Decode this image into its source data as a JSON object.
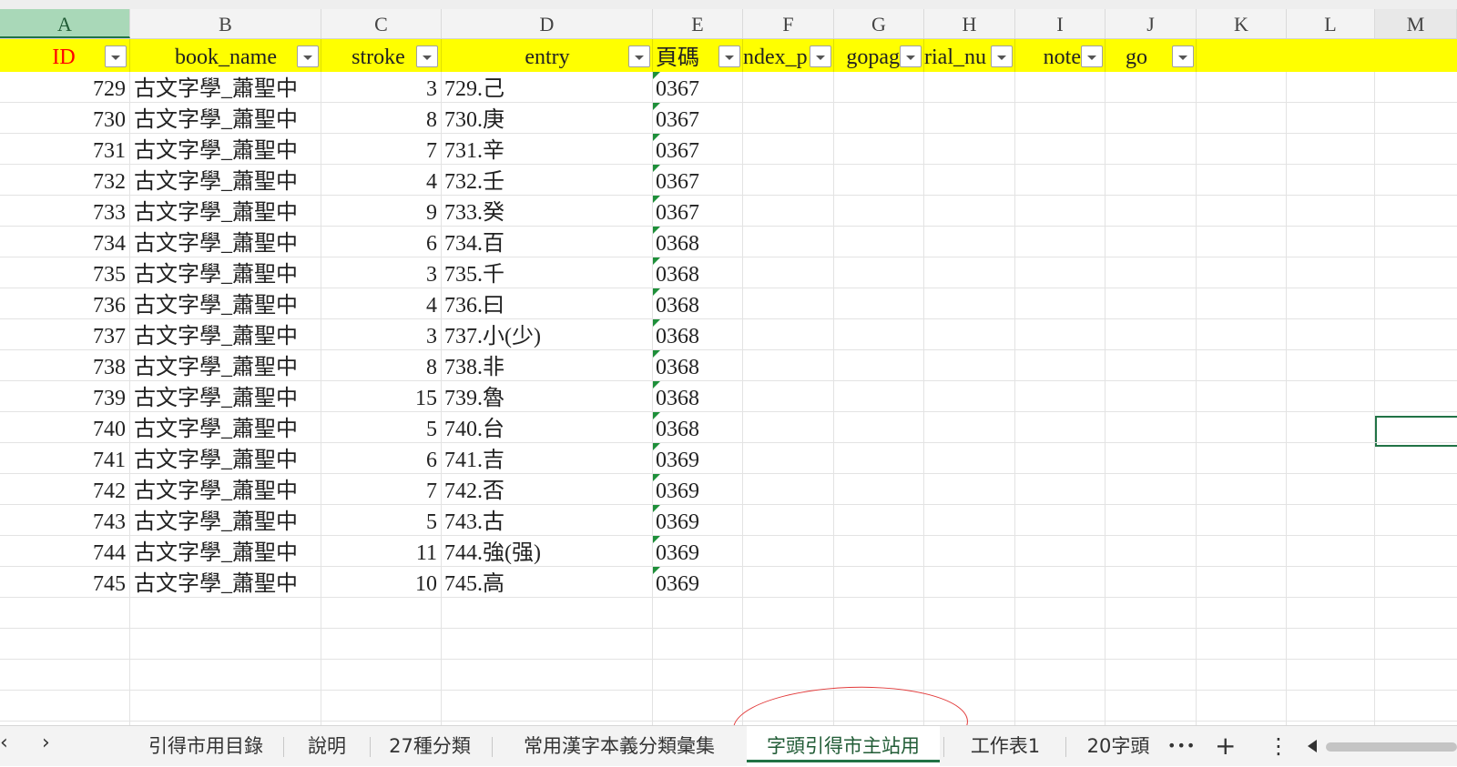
{
  "columns": [
    "A",
    "B",
    "C",
    "D",
    "E",
    "F",
    "G",
    "H",
    "I",
    "J",
    "K",
    "L",
    "M"
  ],
  "fields": [
    "ID",
    "book_name",
    "stroke",
    "entry",
    "頁碼",
    "ndex_p",
    "gopag",
    "rial_nu",
    "note",
    "go"
  ],
  "rows": [
    {
      "id": "729",
      "book_name": "古文字學_蕭聖中",
      "stroke": "3",
      "entry": "729.己",
      "page": "0367"
    },
    {
      "id": "730",
      "book_name": "古文字學_蕭聖中",
      "stroke": "8",
      "entry": "730.庚",
      "page": "0367"
    },
    {
      "id": "731",
      "book_name": "古文字學_蕭聖中",
      "stroke": "7",
      "entry": "731.辛",
      "page": "0367"
    },
    {
      "id": "732",
      "book_name": "古文字學_蕭聖中",
      "stroke": "4",
      "entry": "732.壬",
      "page": "0367"
    },
    {
      "id": "733",
      "book_name": "古文字學_蕭聖中",
      "stroke": "9",
      "entry": "733.癸",
      "page": "0367"
    },
    {
      "id": "734",
      "book_name": "古文字學_蕭聖中",
      "stroke": "6",
      "entry": "734.百",
      "page": "0368"
    },
    {
      "id": "735",
      "book_name": "古文字學_蕭聖中",
      "stroke": "3",
      "entry": "735.千",
      "page": "0368"
    },
    {
      "id": "736",
      "book_name": "古文字學_蕭聖中",
      "stroke": "4",
      "entry": "736.曰",
      "page": "0368"
    },
    {
      "id": "737",
      "book_name": "古文字學_蕭聖中",
      "stroke": "3",
      "entry": "737.小(少)",
      "page": "0368"
    },
    {
      "id": "738",
      "book_name": "古文字學_蕭聖中",
      "stroke": "8",
      "entry": "738.非",
      "page": "0368"
    },
    {
      "id": "739",
      "book_name": "古文字學_蕭聖中",
      "stroke": "15",
      "entry": "739.魯",
      "page": "0368"
    },
    {
      "id": "740",
      "book_name": "古文字學_蕭聖中",
      "stroke": "5",
      "entry": "740.台",
      "page": "0368"
    },
    {
      "id": "741",
      "book_name": "古文字學_蕭聖中",
      "stroke": "6",
      "entry": "741.吉",
      "page": "0369"
    },
    {
      "id": "742",
      "book_name": "古文字學_蕭聖中",
      "stroke": "7",
      "entry": "742.否",
      "page": "0369"
    },
    {
      "id": "743",
      "book_name": "古文字學_蕭聖中",
      "stroke": "5",
      "entry": "743.古",
      "page": "0369"
    },
    {
      "id": "744",
      "book_name": "古文字學_蕭聖中",
      "stroke": "11",
      "entry": "744.強(强)",
      "page": "0369"
    },
    {
      "id": "745",
      "book_name": "古文字學_蕭聖中",
      "stroke": "10",
      "entry": "745.高",
      "page": "0369"
    }
  ],
  "sheet_tabs": [
    {
      "label": "引得市用目錄",
      "active": false
    },
    {
      "label": "說明",
      "active": false
    },
    {
      "label": "27種分類",
      "active": false
    },
    {
      "label": "常用漢字本義分類彙集",
      "active": false
    },
    {
      "label": "字頭引得市主站用",
      "active": true
    },
    {
      "label": "工作表1",
      "active": false
    },
    {
      "label": "20字頭",
      "active": false
    }
  ],
  "tab_controls": {
    "prev": "‹",
    "next": "›",
    "more": "•••",
    "add": "+",
    "menu": "⋮"
  },
  "colors": {
    "header_yellow": "#ffff00",
    "id_red": "#ff0000",
    "accent_green": "#217346",
    "annotation_red": "#e23a3a"
  }
}
